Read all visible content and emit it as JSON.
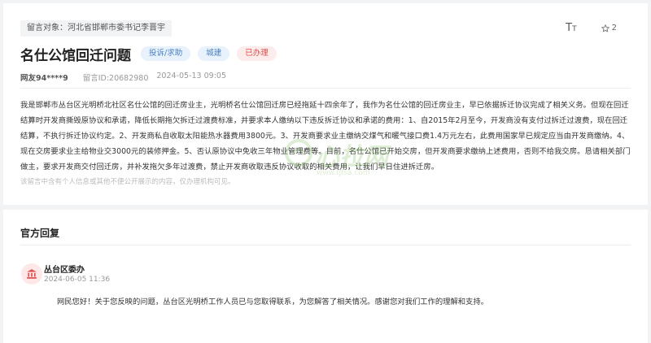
{
  "message": {
    "target_label": "留言对象：",
    "target_value": "河北省邯郸市委书记李晋宇",
    "title": "名仕公馆回迁问题",
    "tags": [
      "投诉/求助",
      "城建"
    ],
    "status": "已办理",
    "font_size_icon": "font-size-icon",
    "favorite_count": "2",
    "user": "网友94****9",
    "message_id": "留言ID:20682980",
    "date": "2024-05-13 09:05",
    "content": "我是邯郸市丛台区光明桥北社区名仕公馆的回迁房业主，光明桥名仕公馆回迁房已经拖延十四余年了，我作为名仕公馆的回迁房业主，早已依据拆迁协议完成了相关义务。但现在回迁结算时开发商撕毁原协议和承诺，降低长期拖欠拆迁过渡费标准，并要求本人缴纳以下违反拆迁协议和承诺的费用：1、自2015年2月至今，开发商没有支付过拆迁过渡费，现在回迁结算，不执行拆迁协议约定。2、开发商私自收取太阳能热水器费用3800元。3、开发商要求业主缴纳交煤气和暖气接口费1.4万元左右，此费用国家早已规定应当由开发商缴纳。4、现在交房要求业主给物业交3000元的装修押金。5、否认原协议中免收三年物业管理费等。目前，名仕公馆已开始交房，但开发商要求缴纳上述费用，否则不给我交房。恳请相关部门做主，要求开发商交付回迁房，并补发拖欠多年过渡费，禁止开发商收取违反协议收取的相关费用，让我们早日住进拆迁房。",
    "privacy_note": "该留言中含有个人信息或其他不便公开展示的内容，仅办理机构可见。",
    "watermark_text": "心拉网",
    "watermark_url": "www.tjfsa.com"
  },
  "reply": {
    "section_title": "官方回复",
    "department": "丛台区委办",
    "time": "2024-06-05 11:36",
    "text": "网民您好！关于您反映的问题，丛台区光明桥工作人员已与您取得联系，为您解答了相关情况。感谢您对我们工作的理解和支持。"
  },
  "colors": {
    "tag_blue_bg": "#e8f2fc",
    "tag_blue_text": "#4a7fc1",
    "status_red_bg": "#fdecec",
    "status_red_text": "#e14b4b",
    "avatar_red": "#e05252"
  }
}
